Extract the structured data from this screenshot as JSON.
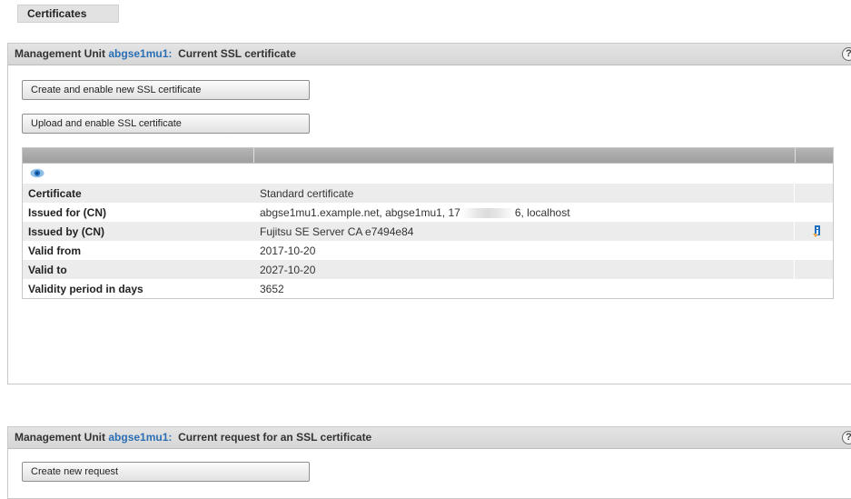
{
  "tab": {
    "label": "Certificates"
  },
  "section1": {
    "prefix": "Management Unit",
    "unit": "abgse1mu1:",
    "title": "Current SSL certificate",
    "help": "?",
    "buttons": {
      "create": "Create and enable new SSL certificate",
      "upload": "Upload and enable SSL certificate"
    },
    "rows": [
      {
        "label": "Certificate",
        "value": "Standard certificate"
      },
      {
        "label": "Issued for (CN)",
        "value_a": "abgse1mu1.example.net, abgse1mu1, 17",
        "value_b": "6, localhost"
      },
      {
        "label": "Issued by (CN)",
        "value": "Fujitsu SE Server CA e7494e84"
      },
      {
        "label": "Valid from",
        "value": "2017-10-20"
      },
      {
        "label": "Valid to",
        "value": "2027-10-20"
      },
      {
        "label": "Validity period in days",
        "value": "3652"
      }
    ],
    "icons": {
      "view": "eye-icon",
      "info": "info-icon"
    }
  },
  "section2": {
    "prefix": "Management Unit",
    "unit": "abgse1mu1:",
    "title": "Current request for an SSL certificate",
    "help": "?",
    "buttons": {
      "create_request": "Create new request"
    }
  },
  "colors": {
    "accent": "#2a6fb5",
    "header_bg": "#dcdcdc",
    "row_alt": "#ececec"
  }
}
